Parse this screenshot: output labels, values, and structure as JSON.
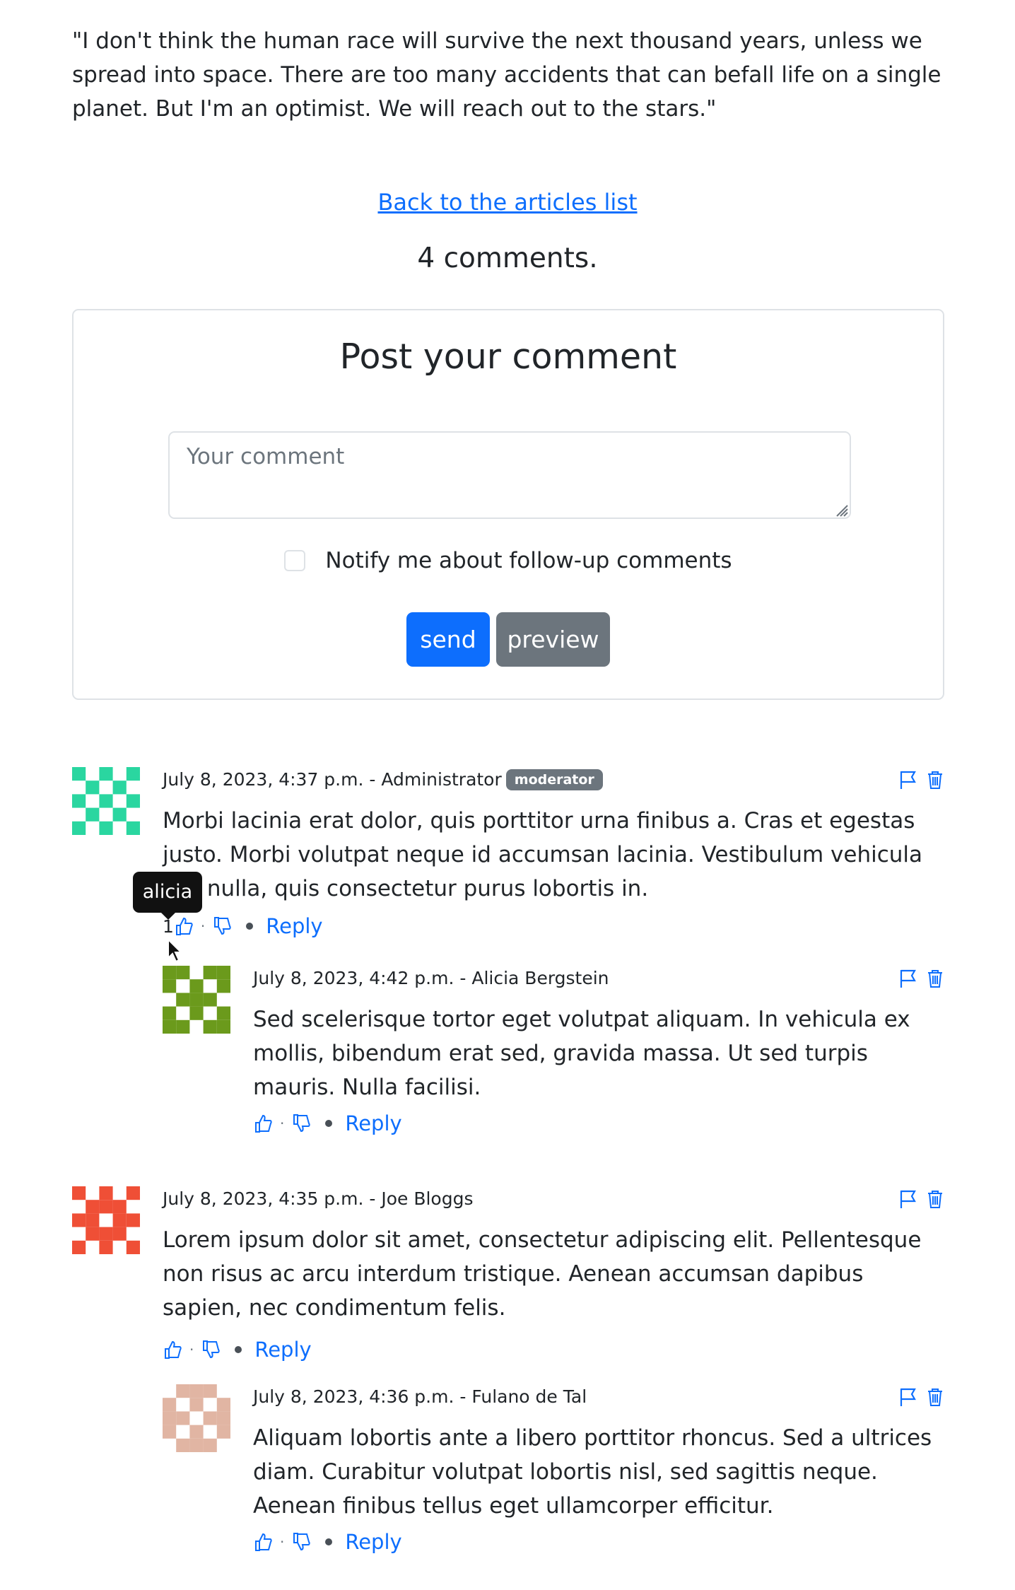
{
  "article": {
    "quote": "\"I don't think the human race will survive the next thousand years, unless we spread into space. There are too many accidents that can befall life on a single planet. But I'm an optimist. We will reach out to the stars.\""
  },
  "nav": {
    "back_link": "Back to the articles list"
  },
  "comments_count": "4 comments.",
  "post_form": {
    "title": "Post your comment",
    "placeholder": "Your comment",
    "notify_label": "Notify me about follow-up comments",
    "send_label": "send",
    "preview_label": "preview"
  },
  "tooltip": "alicia",
  "comments": [
    {
      "meta": "July 8, 2023, 4:37 p.m. - Administrator",
      "badge": "moderator",
      "text": "Morbi lacinia erat dolor, quis porttitor urna finibus a. Cras et egestas justo. Morbi volutpat neque id accumsan lacinia. Vestibulum vehicula nisl nulla, quis consectetur purus lobortis in.",
      "likes": "1",
      "reply": "Reply",
      "avatar_color": "#2ad6a0"
    },
    {
      "meta": "July 8, 2023, 4:42 p.m. - Alicia Bergstein",
      "text": "Sed scelerisque tortor eget volutpat aliquam. In vehicula ex mollis, bibendum erat sed, gravida massa. Ut sed turpis mauris. Nulla facilisi.",
      "reply": "Reply",
      "avatar_color": "#6b9a1c"
    },
    {
      "meta": "July 8, 2023, 4:35 p.m. - Joe Bloggs",
      "text": "Lorem ipsum dolor sit amet, consectetur adipiscing elit. Pellentesque non risus ac arcu interdum tristique. Aenean accumsan dapibus sapien, nec condimentum felis.",
      "reply": "Reply",
      "avatar_color": "#ef4f36"
    },
    {
      "meta": "July 8, 2023, 4:36 p.m. - Fulano de Tal",
      "text": "Aliquam lobortis ante a libero porttitor rhoncus. Sed a ultrices diam. Curabitur volutpat lobortis nisl, sed sagittis neque. Aenean finibus tellus eget ullamcorper efficitur.",
      "reply": "Reply",
      "avatar_color": "#e1b5a3"
    }
  ]
}
